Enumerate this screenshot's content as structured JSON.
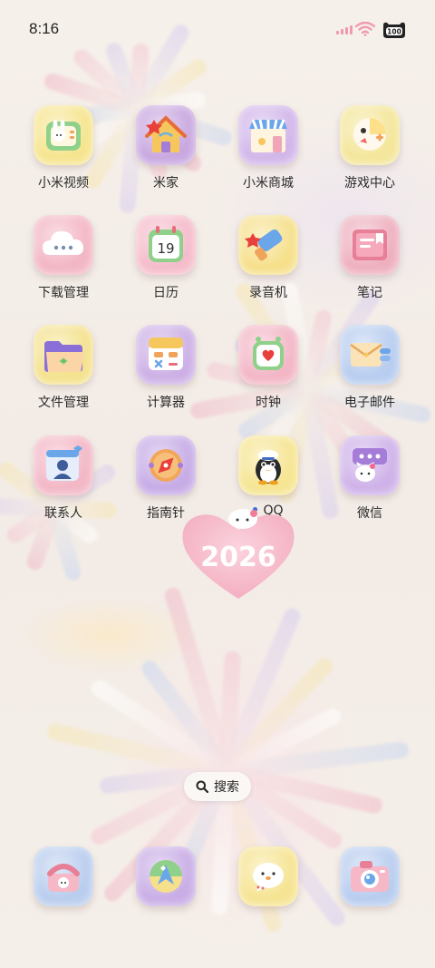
{
  "status_bar": {
    "time": "8:16",
    "battery_label": "100"
  },
  "apps": [
    {
      "label": "小米视频",
      "icon": "tv-bunny-icon",
      "bg": "#f6e58f"
    },
    {
      "label": "米家",
      "icon": "smart-home-icon",
      "bg": "#c9a8e0"
    },
    {
      "label": "小米商城",
      "icon": "store-icon",
      "bg": "#d2b6ea"
    },
    {
      "label": "游戏中心",
      "icon": "game-controller-icon",
      "bg": "#f4e69a"
    },
    {
      "label": "下载管理",
      "icon": "cloud-download-icon",
      "bg": "#f3b6c4"
    },
    {
      "label": "日历",
      "icon": "calendar-icon",
      "bg": "#f5bccb"
    },
    {
      "label": "录音机",
      "icon": "recorder-icon",
      "bg": "#f6e08c"
    },
    {
      "label": "笔记",
      "icon": "notes-icon",
      "bg": "#eeb0bf"
    },
    {
      "label": "文件管理",
      "icon": "folder-icon",
      "bg": "#f4e28e"
    },
    {
      "label": "计算器",
      "icon": "calculator-icon",
      "bg": "#cdb0e6"
    },
    {
      "label": "时钟",
      "icon": "clock-icon",
      "bg": "#f3b6c6"
    },
    {
      "label": "电子邮件",
      "icon": "email-icon",
      "bg": "#b8cdef"
    },
    {
      "label": "联系人",
      "icon": "contacts-icon",
      "bg": "#f3b7c6"
    },
    {
      "label": "指南针",
      "icon": "compass-icon",
      "bg": "#c7ace6"
    },
    {
      "label": "QQ",
      "icon": "qq-penguin-icon",
      "bg": "#f6e592"
    },
    {
      "label": "微信",
      "icon": "wechat-icon",
      "bg": "#cfb2e9"
    }
  ],
  "qq_notification_dot": true,
  "widget": {
    "year": "2026"
  },
  "search": {
    "label": "搜索"
  },
  "dock": [
    {
      "icon": "phone-icon",
      "bg": "#b9cdee"
    },
    {
      "icon": "browser-icon",
      "bg": "#c9aee6"
    },
    {
      "icon": "messages-icon",
      "bg": "#f6e493"
    },
    {
      "icon": "camera-icon",
      "bg": "#b9cdef"
    }
  ]
}
